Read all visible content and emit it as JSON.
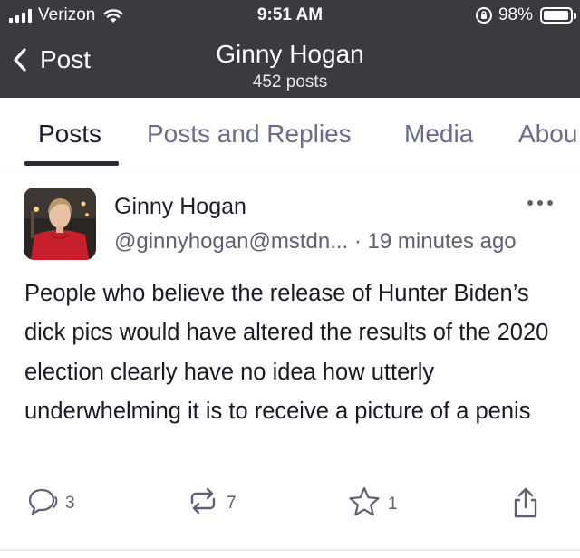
{
  "status_bar": {
    "carrier": "Verizon",
    "time": "9:51 AM",
    "battery": "98%",
    "battery_level": 0.98
  },
  "header": {
    "back_label": "Post",
    "title": "Ginny Hogan",
    "subtitle": "452 posts"
  },
  "tabs": [
    {
      "label": "Posts",
      "active": true
    },
    {
      "label": "Posts and Replies",
      "active": false
    },
    {
      "label": "Media",
      "active": false
    },
    {
      "label": "Abou",
      "active": false
    }
  ],
  "post": {
    "author": "Ginny Hogan",
    "handle": "@ginnyhogan@mstdn...",
    "separator": "·",
    "time": "19 minutes ago",
    "text": "People who believe the release of Hunter Biden’s dick pics would have altered the results of the 2020 election clearly have no idea how utterly underwhelming it is to receive a picture of a penis",
    "replies": "3",
    "boosts": "7",
    "favourites": "1"
  },
  "icons": {
    "signal": "signal-bars-icon",
    "wifi": "wifi-icon",
    "rotation_lock": "rotation-lock-icon",
    "battery": "battery-icon",
    "back": "chevron-left-icon",
    "more": "ellipsis-icon",
    "reply": "reply-bubble-icon",
    "boost": "boost-icon",
    "favourite": "star-icon",
    "share": "share-icon"
  },
  "colors": {
    "header_bg": "#3b3b3f",
    "tab_active": "#1c1c28",
    "tab_inactive": "#6c6c8a",
    "muted_text": "#5f6172"
  }
}
